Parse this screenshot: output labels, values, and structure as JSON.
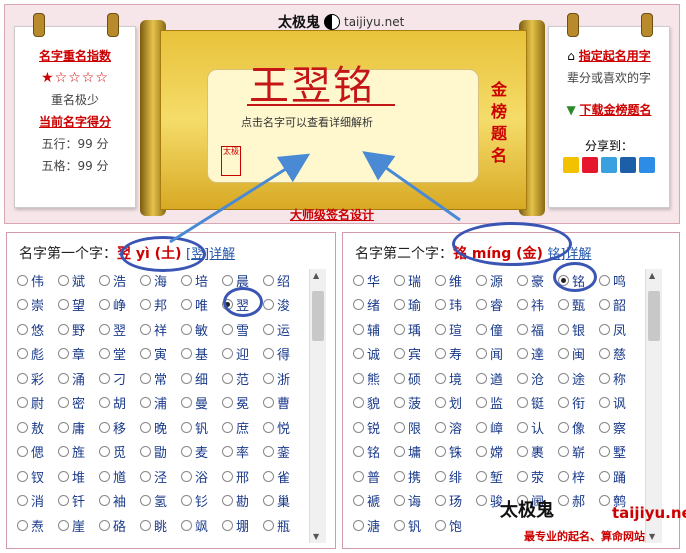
{
  "brand": {
    "logo_text": "太极鬼",
    "url": "taijiyu.net"
  },
  "left_panel": {
    "title": "名字重名指数",
    "stars": "★☆☆☆☆",
    "level": "重名极少",
    "score_title": "当前名字得分",
    "wuxing": "五行：99 分",
    "wuge": "五格：99 分"
  },
  "scroll": {
    "name": "王翌铭",
    "hint": "点击名字可以查看详细解析",
    "vertical": "金榜题名",
    "seal": "太极",
    "design_link": "大师级签名设计"
  },
  "right_panel": {
    "custom_link": "指定起名用字",
    "custom_sub": "辈分或喜欢的字",
    "download_link": "下载金榜题名",
    "share": "分享到："
  },
  "section1": {
    "label": "名字第一个字：",
    "selected": "翌 yì (土)",
    "detail": "[翌]详解"
  },
  "section2": {
    "label": "名字第二个字：",
    "selected": "铭 míng (金)",
    "detail": "铭]详解"
  },
  "grid1": [
    [
      "伟",
      "斌",
      "浩",
      "海",
      "培",
      "晨",
      "绍"
    ],
    [
      "崇",
      "望",
      "峥",
      "邦",
      "唯",
      "翌",
      "浚"
    ],
    [
      "悠",
      "野",
      "翌",
      "祥",
      "敏",
      "雪",
      "运"
    ],
    [
      "彪",
      "章",
      "堂",
      "寅",
      "基",
      "迎",
      "得"
    ],
    [
      "彩",
      "涌",
      "刁",
      "常",
      "细",
      "范",
      "浙"
    ],
    [
      "尉",
      "密",
      "胡",
      "浦",
      "曼",
      "冕",
      "曹"
    ],
    [
      "敖",
      "庸",
      "移",
      "晚",
      "钒",
      "庶",
      "悦"
    ],
    [
      "偲",
      "旌",
      "觅",
      "勖",
      "麦",
      "率",
      "銮"
    ],
    [
      "钗",
      "堆",
      "馗",
      "泾",
      "浴",
      "邢",
      "雀"
    ],
    [
      "消",
      "钎",
      "袖",
      "氢",
      "钐",
      "勘",
      "巢"
    ],
    [
      "焘",
      "崖",
      "硌",
      "眺",
      "飒",
      "堋",
      "瓶"
    ]
  ],
  "grid2": [
    [
      "华",
      "瑞",
      "维",
      "源",
      "豪",
      "铭",
      "鸣"
    ],
    [
      "绪",
      "瑜",
      "玮",
      "睿",
      "祎",
      "甄",
      "韶"
    ],
    [
      "辅",
      "瑀",
      "瑄",
      "僮",
      "福",
      "银",
      "凤"
    ],
    [
      "诚",
      "宾",
      "寿",
      "闻",
      "達",
      "闽",
      "慈"
    ],
    [
      "熊",
      "硕",
      "境",
      "遒",
      "沧",
      "途",
      "称"
    ],
    [
      "貌",
      "菠",
      "划",
      "监",
      "铤",
      "衔",
      "讽"
    ],
    [
      "锐",
      "限",
      "溶",
      "嶂",
      "认",
      "像",
      "察"
    ],
    [
      "铭",
      "墉",
      "铢",
      "嫦",
      "裹",
      "崭",
      "墅"
    ],
    [
      "普",
      "携",
      "绯",
      "堑",
      "荥",
      "梓",
      "踊"
    ],
    [
      "褫",
      "诲",
      "玚",
      "骏",
      "阃",
      "郝",
      "鹩"
    ],
    [
      "溏",
      "钒",
      "饱",
      "",
      "",
      "",
      ""
    ]
  ],
  "watermark": {
    "logo": "太极鬼",
    "url": "taijiyu.net",
    "slogan": "最专业的起名、算命网站"
  }
}
